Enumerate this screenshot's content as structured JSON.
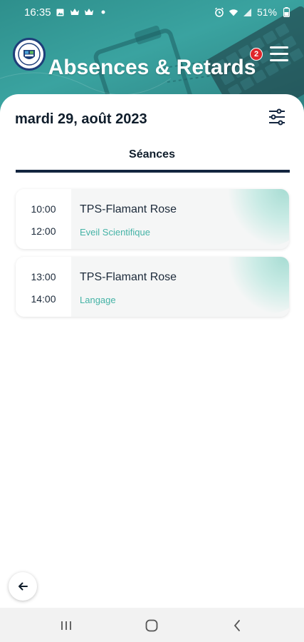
{
  "status_bar": {
    "time": "16:35",
    "battery": "51%",
    "left_icons": [
      "gallery-icon",
      "crown-icon",
      "crown-icon",
      "dot-icon"
    ],
    "right_icons": [
      "alarm-icon",
      "wifi-icon",
      "signal-icon",
      "battery-icon"
    ]
  },
  "header": {
    "title": "Absences & Retards",
    "notification_count": "2",
    "background_color": "#3aa3a0"
  },
  "content": {
    "date": "mardi 29, août 2023",
    "tab_label": "Séances",
    "sessions": [
      {
        "start": "10:00",
        "end": "12:00",
        "class_name": "TPS-Flamant Rose",
        "subject": "Eveil Scientifique"
      },
      {
        "start": "13:00",
        "end": "14:00",
        "class_name": "TPS-Flamant Rose",
        "subject": "Langage"
      }
    ]
  },
  "colors": {
    "accent": "#45b3a6",
    "dark_navy": "#13253f",
    "badge": "#e0262b"
  }
}
